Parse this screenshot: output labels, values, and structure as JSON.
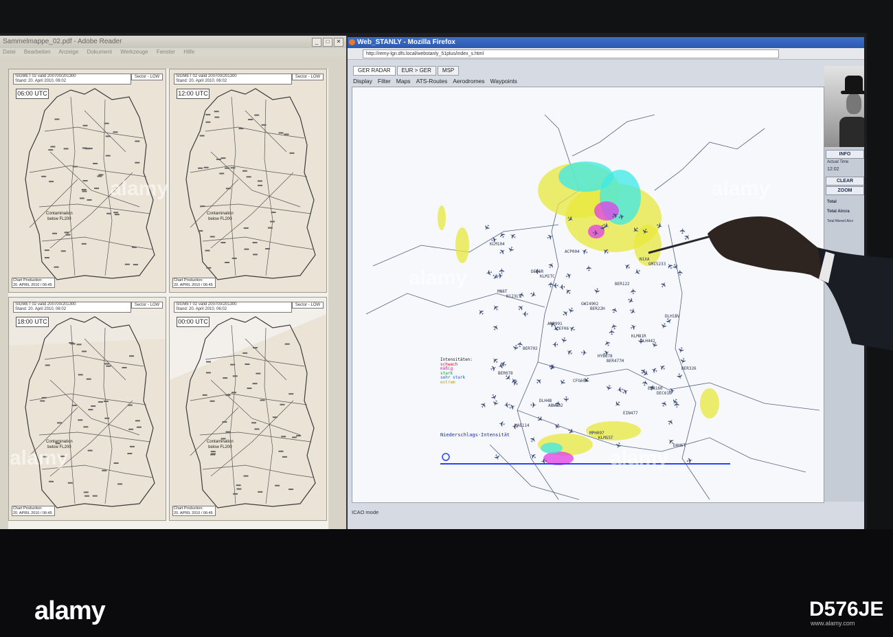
{
  "reader": {
    "title": "Sammelmappe_02.pdf - Adobe Reader",
    "menu": [
      "Datei",
      "Bearbeiten",
      "Anzeige",
      "Dokument",
      "Werkzeuge",
      "Fenster",
      "Hilfe"
    ],
    "panels": [
      {
        "header": "SIGMET 02 valid 200700/201300\nStand: 20. April 2010, 06:02",
        "sector": "Sector - LOW",
        "time": "06:00 UTC",
        "contamination": "Contamination\nbelow FL200",
        "footer": "Chart Production:\n20. APRIL 2010 / 06:45"
      },
      {
        "header": "SIGMET 02 valid 200700/201300\nStand: 20. April 2010, 06:02",
        "sector": "Sector - LOW",
        "time": "12:00 UTC",
        "contamination": "Contamination\nbelow FL200",
        "footer": "Chart Production:\n20. APRIL 2010 / 06:45"
      },
      {
        "header": "SIGMET 02 valid 200700/201300\nStand: 20. April 2010, 06:02",
        "sector": "Sector - LOW",
        "time": "18:00 UTC",
        "contamination": "Contamination\nbelow FL200",
        "footer": "Chart Production:\n20. APRIL 2010 / 06:45"
      },
      {
        "header": "SIGMET 02 valid 200700/201300\nStand: 20. April 2010, 06:02",
        "sector": "Sector - LOW",
        "time": "00:00 UTC",
        "contamination": "Contamination\nbelow FL200",
        "footer": "Chart Production:\n20. APRIL 2010 / 06:45"
      }
    ]
  },
  "firefox": {
    "title": "Web_STANLY - Mozilla Firefox",
    "url": "http://remy-lgn.dfs.local/webstanly_51plus/index_s.html",
    "tabs": [
      "GER RADAR",
      "EUR > GER",
      "MSP"
    ],
    "menu": [
      "Display",
      "Filter",
      "Maps",
      "ATS-Routes",
      "Aerodromes",
      "Waypoints"
    ],
    "status": "ICAO mode",
    "legend": [
      {
        "text": "Intensitäten:",
        "color": "#1a1a1a"
      },
      {
        "text": "schwach",
        "color": "#e01010"
      },
      {
        "text": "mäßig",
        "color": "#d018c0"
      },
      {
        "text": "stark",
        "color": "#10a010"
      },
      {
        "text": "sehr stark",
        "color": "#1060e0"
      },
      {
        "text": "extrem",
        "color": "#e0c010"
      }
    ],
    "legend_footer": "Niederschlags-Intensität",
    "flight_labels": [
      "KLM104",
      "KLM1TC",
      "BER22H",
      "DLH442",
      "BER078",
      "ABW662",
      "KLM55T",
      "GMI5233",
      "N123LV",
      "CEF06",
      "BER477H",
      "DEC616",
      "MAE114",
      "ACP004",
      "BER122",
      "DLH1BV",
      "BER702",
      "CFG604",
      "EIN477",
      "DAH6T",
      "DEO6R",
      "GWI4902",
      "KLM81R",
      "BER326",
      "DLH4B",
      "MPH097",
      "N1XA",
      "MN8T",
      "AM8991",
      "HYB678",
      "EWR160"
    ],
    "colors": {
      "precip_yellow": "#e8e83c",
      "precip_cyan": "#3ce8e8",
      "precip_magenta": "#e23ce8",
      "aircraft": "#3a4a78",
      "border": "#506080",
      "ruler": "#2244ff"
    }
  },
  "side": {
    "buttons": [
      "INFO",
      "CLEAR",
      "ZOOM"
    ],
    "actual_time_label": "Actual Time",
    "actual_time": "12:02",
    "total_label": "Total",
    "total_aircraft_label": "Total Aircra",
    "total_filtered_label": "Total filtered Aircr"
  },
  "watermark": {
    "brand": "alamy",
    "code": "D576JE",
    "small": "www.alamy.com"
  }
}
